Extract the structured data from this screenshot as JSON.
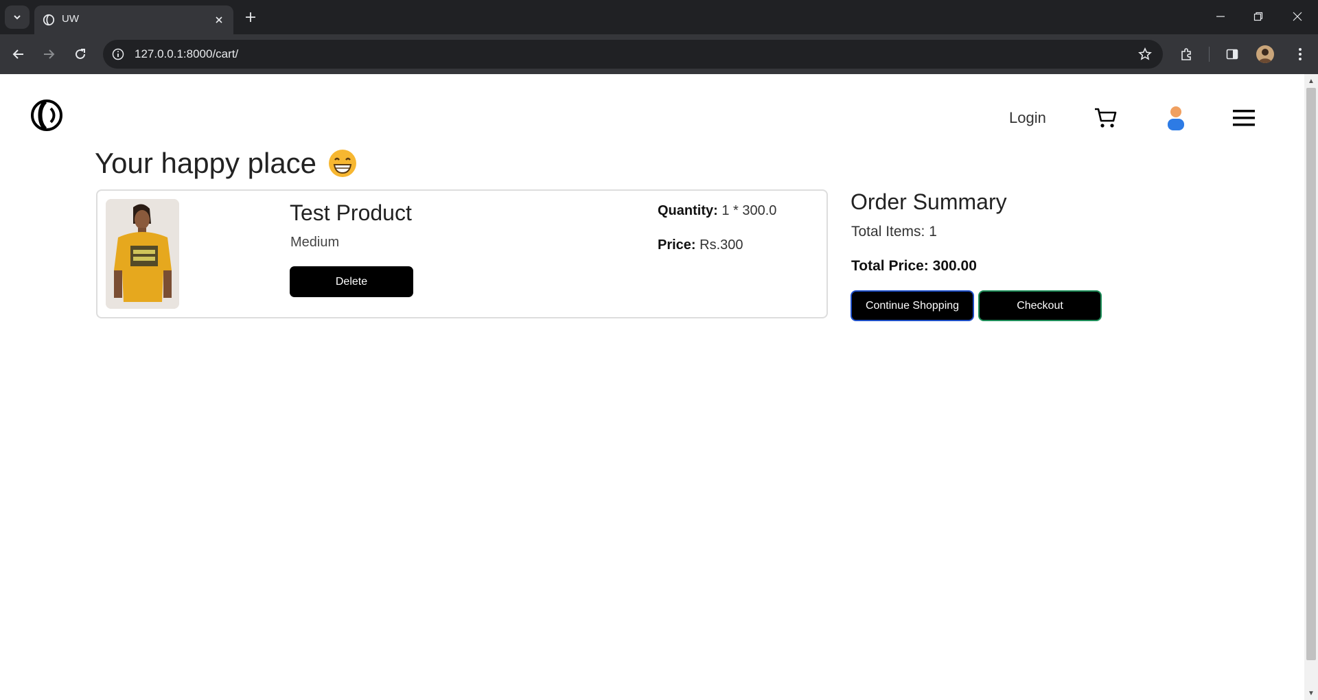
{
  "browser": {
    "tab_title": "UW",
    "url": "127.0.0.1:8000/cart/",
    "icons": [
      "tab-search-icon",
      "close-icon",
      "plus-icon",
      "minimize-icon",
      "restore-icon",
      "window-close-icon",
      "back-arrow-icon",
      "forward-arrow-icon",
      "reload-icon",
      "info-icon",
      "star-icon",
      "extensions-icon",
      "side-panel-icon",
      "profile-avatar",
      "more-vert-icon"
    ]
  },
  "header": {
    "login_label": "Login",
    "icons": [
      "site-logo",
      "cart-icon",
      "user-icon",
      "hamburger-menu-icon"
    ]
  },
  "page": {
    "title": "Your happy place",
    "title_emoji": "grinning-face-emoji"
  },
  "cart": {
    "item": {
      "name": "Test Product",
      "size": "Medium",
      "delete_label": "Delete",
      "quantity_label": "Quantity:",
      "quantity_value": "1 * 300.0",
      "price_label": "Price:",
      "price_value": "Rs.300"
    }
  },
  "summary": {
    "title": "Order Summary",
    "total_items": "Total Items: 1",
    "total_price": "Total Price: 300.00",
    "continue_label": "Continue Shopping",
    "checkout_label": "Checkout"
  },
  "colors": {
    "chrome_dark": "#202124",
    "chrome_toolbar": "#35363a",
    "button_black": "#000000",
    "continue_border": "#1e4fc8",
    "checkout_border": "#1f8f5a",
    "user_icon_head": "#f0a060",
    "user_icon_body": "#2d7be5"
  }
}
